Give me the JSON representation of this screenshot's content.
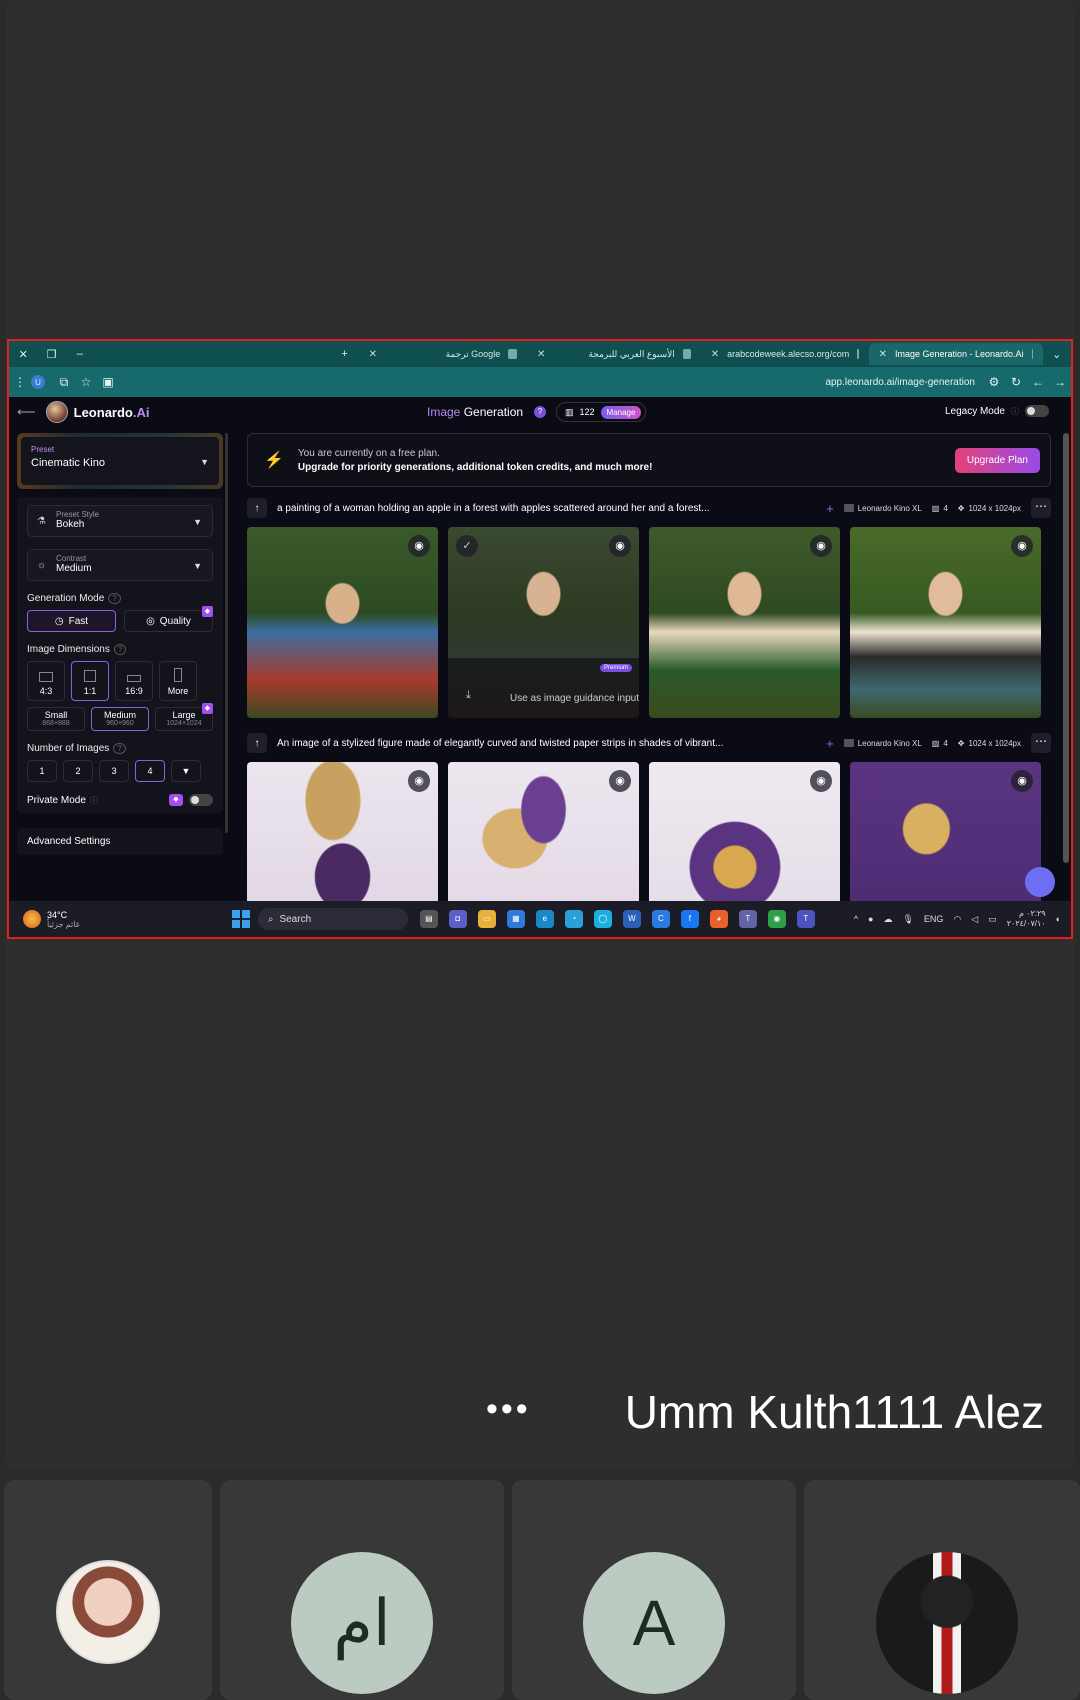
{
  "browser": {
    "tabs": [
      {
        "label": "ترجمة Google",
        "active": false
      },
      {
        "label": "الأسبوع العربي للبرمجة",
        "active": false
      },
      {
        "label": "arabcodeweek.alecso.org/com",
        "active": false
      },
      {
        "label": "Image Generation - Leonardo.Ai",
        "active": true
      }
    ],
    "url": "app.leonardo.ai/image-generation",
    "profile_initial": "U"
  },
  "app": {
    "brand": "Leonardo",
    "brand_suffix": ".Ai",
    "title_highlight": "Image",
    "title_rest": " Generation",
    "tokens": "122",
    "manage_label": "Manage",
    "legacy_label": "Legacy Mode"
  },
  "sidebar": {
    "preset_label": "Preset",
    "preset_value": "Cinematic Kino",
    "preset_style_label": "Preset Style",
    "preset_style_value": "Bokeh",
    "contrast_label": "Contrast",
    "contrast_value": "Medium",
    "generation_mode_label": "Generation Mode",
    "mode_fast": "Fast",
    "mode_quality": "Quality",
    "image_dimensions_label": "Image Dimensions",
    "ratios": [
      "4:3",
      "1:1",
      "16:9",
      "More"
    ],
    "sizes": [
      {
        "label": "Small",
        "sub": "868×888"
      },
      {
        "label": "Medium",
        "sub": "960×960"
      },
      {
        "label": "Large",
        "sub": "1024×1024"
      }
    ],
    "number_of_images_label": "Number of Images",
    "counts": [
      "1",
      "2",
      "3",
      "4"
    ],
    "private_mode_label": "Private Mode",
    "advanced_label": "Advanced Settings"
  },
  "banner": {
    "line1": "You are currently on a free plan.",
    "line2": "Upgrade for priority generations, additional token credits, and much more!",
    "button": "Upgrade Plan"
  },
  "generations": [
    {
      "prompt": "a painting of a woman holding an apple in a forest with apples scattered around her and a forest...",
      "model": "Leonardo Kino XL",
      "count": "4",
      "size": "1024 x 1024px"
    },
    {
      "prompt": "An image of a stylized figure made of elegantly curved and twisted paper strips in shades of vibrant...",
      "model": "Leonardo Kino XL",
      "count": "4",
      "size": "1024 x 1024px"
    }
  ],
  "image_overlay": {
    "tooltip": "Use as image guidance input",
    "premium": "Premium"
  },
  "taskbar": {
    "temperature": "34°C",
    "weather_text": "غائم جزئياً",
    "search": "Search",
    "lang": "ENG",
    "time": "٠٢:٢٩ م",
    "date": "٢٠٢٤/٠٧/١٠"
  },
  "meeting": {
    "presenter": "Umm Kulth1111 Alez",
    "participants": [
      {
        "initials": ""
      },
      {
        "initials": "ام"
      },
      {
        "initials": "A"
      },
      {
        "initials": ""
      }
    ]
  },
  "colors": {
    "accent": "#8e5ee6",
    "share_border": "#e0201e",
    "tab_bar": "#0f4f50"
  }
}
